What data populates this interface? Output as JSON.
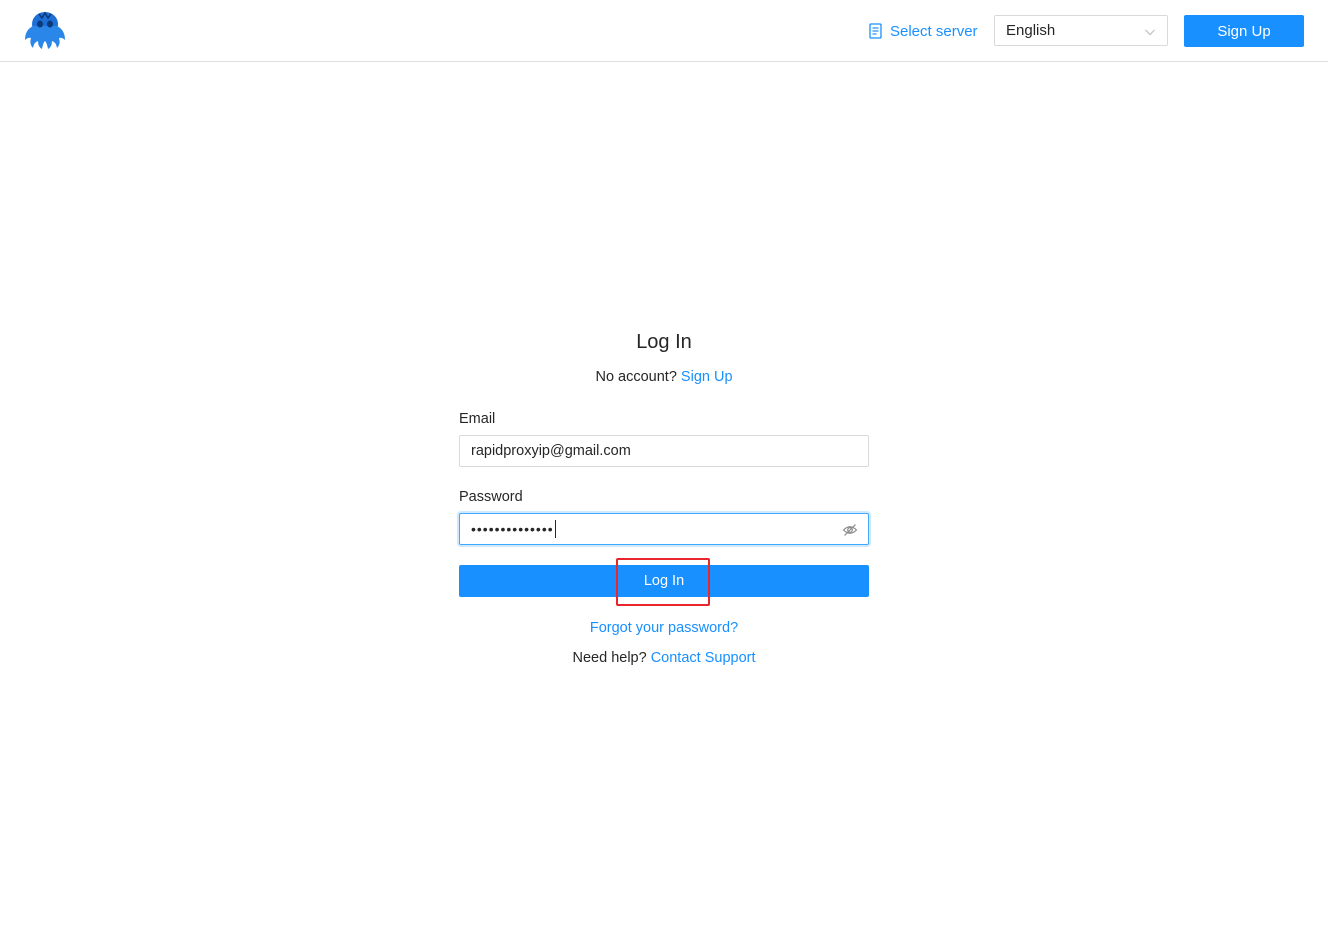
{
  "header": {
    "logo_icon": "octopus-logo-icon",
    "select_server_label": "Select server",
    "server_icon": "server-list-icon",
    "language_value": "English",
    "signup_label": "Sign Up"
  },
  "form": {
    "title": "Log In",
    "no_account_text": "No account?",
    "signup_link": "Sign Up",
    "email_label": "Email",
    "email_value": "rapidproxyip@gmail.com",
    "password_label": "Password",
    "password_masked": "••••••••••••••",
    "eye_icon": "eye-invisible-icon",
    "login_label": "Log In",
    "forgot_link": "Forgot your password?",
    "help_text": "Need help?",
    "support_link": "Contact Support"
  },
  "colors": {
    "primary": "#1890ff",
    "highlight": "#e8262b",
    "text": "#262626",
    "border": "#d9d9d9"
  }
}
